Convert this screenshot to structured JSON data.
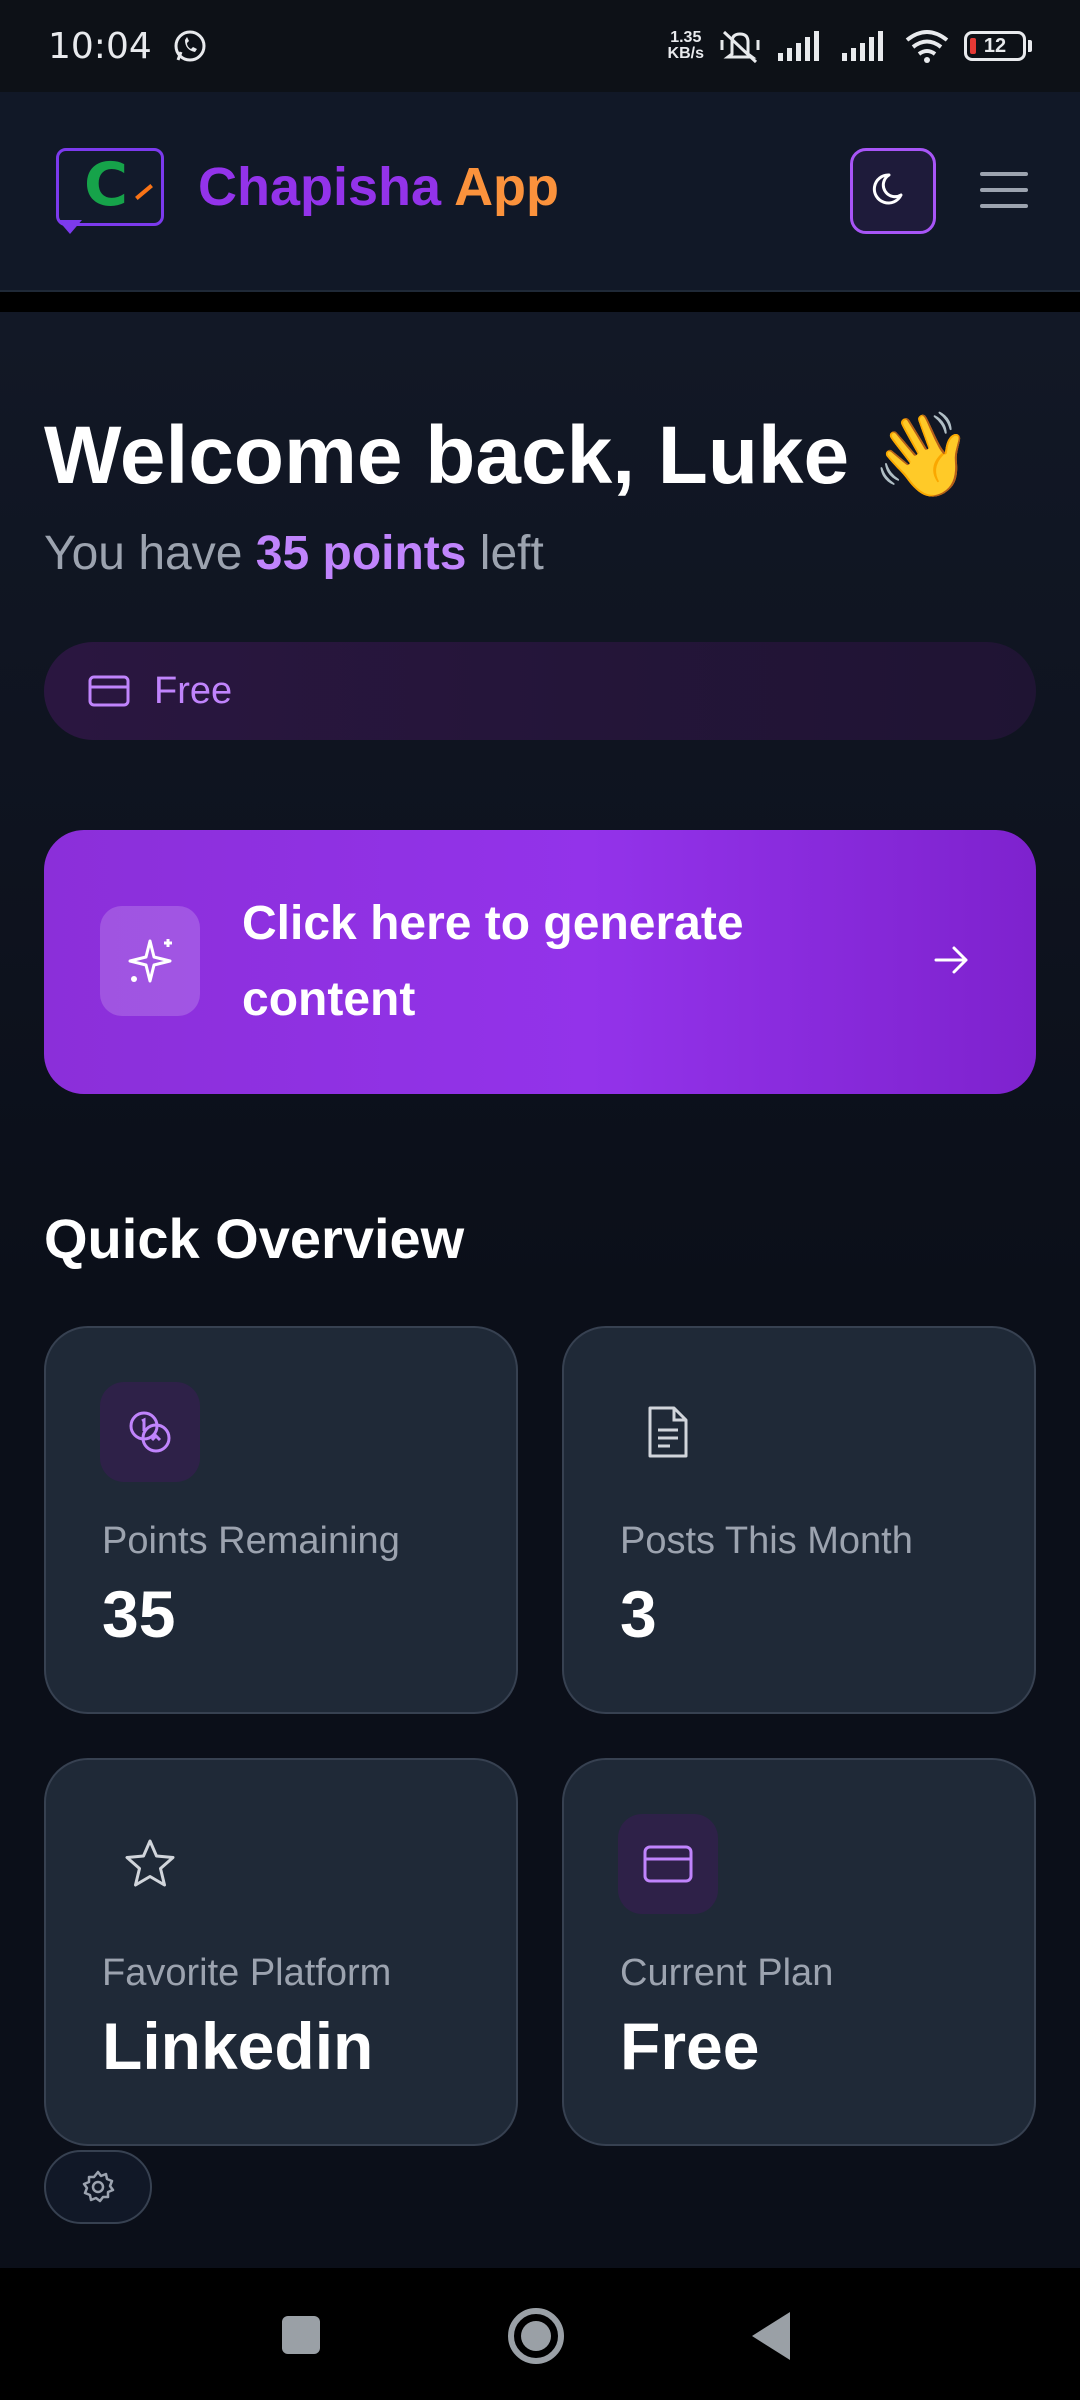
{
  "status_bar": {
    "time": "10:04",
    "net_speed_value": "1.35",
    "net_speed_unit": "KB/s",
    "battery_level": "12",
    "icons": [
      "whatsapp-icon",
      "mute-icon",
      "signal-icon",
      "signal-icon",
      "wifi-icon",
      "battery-icon"
    ]
  },
  "header": {
    "logo_letter": "C",
    "brand_part1": "Chapisha",
    "brand_part2": "App",
    "theme_toggle_icon": "moon-icon",
    "menu_icon": "hamburger-icon"
  },
  "welcome": {
    "title": "Welcome back, Luke 👋",
    "points_prefix": "You have ",
    "points_highlight": "35 points",
    "points_suffix": " left"
  },
  "plan_pill": {
    "icon": "credit-card-icon",
    "label": "Free"
  },
  "cta": {
    "icon": "sparkles-icon",
    "text": "Click here to generate content",
    "arrow_icon": "arrow-right-icon"
  },
  "overview": {
    "title": "Quick Overview",
    "cards": [
      {
        "icon": "coins-icon",
        "label": "Points Remaining",
        "value": "35"
      },
      {
        "icon": "file-text-icon",
        "label": "Posts This Month",
        "value": "3"
      },
      {
        "icon": "star-icon",
        "label": "Favorite Platform",
        "value": "Linkedin"
      },
      {
        "icon": "credit-card-icon",
        "label": "Current Plan",
        "value": "Free"
      }
    ]
  },
  "settings": {
    "icon": "gear-icon"
  },
  "colors": {
    "background": "#0b0f19",
    "header": "#111827",
    "card": "#1f2937",
    "accent_purple": "#9333ea",
    "accent_orange": "#fb923c",
    "highlight": "#c084fc"
  }
}
